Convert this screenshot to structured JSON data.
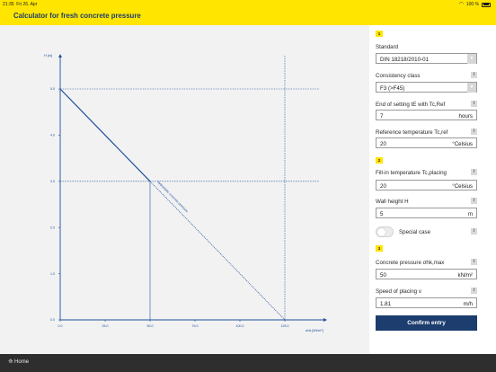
{
  "status_bar": {
    "time": "21:35",
    "date": "Fri 26. Apr",
    "battery": "100 %"
  },
  "app": {
    "title": "Calculator for fresh concrete pressure"
  },
  "chart_data": {
    "type": "line",
    "ylabel": "H [m]",
    "xlabel": "σhk [kN/m²]",
    "x_ticks": [
      0.0,
      25.0,
      50.0,
      75.0,
      100.0,
      125.0
    ],
    "y_ticks": [
      0.0,
      1.0,
      2.0,
      3.0,
      4.0,
      5.0
    ],
    "xlim": [
      0,
      125
    ],
    "ylim": [
      0,
      5
    ],
    "series": [
      {
        "name": "",
        "style": "solid",
        "x": [
          0,
          50
        ],
        "y": [
          5,
          3
        ]
      },
      {
        "name": "hydrostatic concrete pressure",
        "style": "dotted",
        "x": [
          50,
          125
        ],
        "y": [
          3,
          0
        ]
      }
    ],
    "reference_lines": {
      "y": [
        5,
        3
      ],
      "x": [
        50,
        125
      ]
    },
    "annotation": "hydrostatic concrete pressure",
    "colors": {
      "line": "#1c4f9c",
      "background": "#f2f2f2"
    }
  },
  "sections": {
    "s1": "1",
    "s2": "2",
    "s3": "3"
  },
  "form": {
    "standard": {
      "label": "Standard",
      "value": "DIN 18218/2010-01"
    },
    "consistency": {
      "label": "Consistency class",
      "value": "F3 (>F45)"
    },
    "end_setting": {
      "label": "End of setting tE with Tc,Ref",
      "value": "7",
      "unit": "hours"
    },
    "ref_temp": {
      "label": "Reference temperature Tc,ref",
      "value": "20",
      "unit": "°Celsius"
    },
    "fill_temp": {
      "label": "Fill-in temperature Tc,placing",
      "value": "20",
      "unit": "°Celsius"
    },
    "wall_height": {
      "label": "Wall height H",
      "value": "5",
      "unit": "m"
    },
    "special_case": {
      "label": "Special case"
    },
    "concrete_pressure": {
      "label": "Concrete pressure σhk,max",
      "value": "50",
      "unit": "kN/m²"
    },
    "speed": {
      "label": "Speed of placing v",
      "value": "1.81",
      "unit": "m/h"
    },
    "info_glyph": "i",
    "dropdown_glyph": "▼",
    "confirm_label": "Confirm entry"
  },
  "nav": {
    "home_label": "Home",
    "home_glyph": "⟰"
  }
}
